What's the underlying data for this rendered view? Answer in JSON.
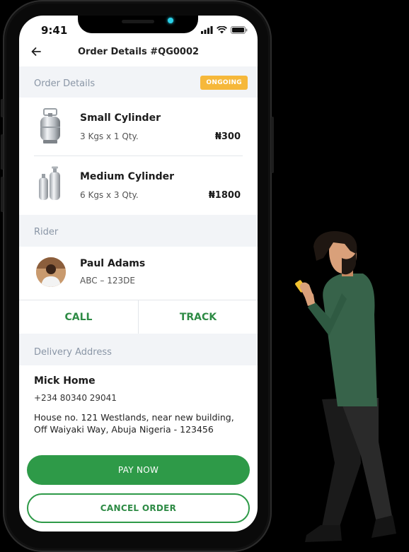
{
  "status_bar": {
    "time": "9:41"
  },
  "header": {
    "title": "Order Details #QG0002"
  },
  "order_section": {
    "label": "Order Details",
    "status": "ONGOING",
    "items": [
      {
        "name": "Small Cylinder",
        "qty": "3 Kgs x 1 Qty.",
        "price": "₦300"
      },
      {
        "name": "Medium Cylinder",
        "qty": "6 Kgs x 3 Qty.",
        "price": "₦1800"
      }
    ]
  },
  "rider_section": {
    "label": "Rider",
    "name": "Paul Adams",
    "plate": "ABC – 123DE",
    "call_label": "CALL",
    "track_label": "TRACK"
  },
  "address_section": {
    "label": "Delivery Address",
    "name": "Mick Home",
    "phone": "+234 80340 29041",
    "line1": "House no. 121 Westlands, near new building,",
    "line2": "Off Waiyaki Way, Abuja Nigeria - 123456"
  },
  "buttons": {
    "pay": "PAY NOW",
    "cancel": "CANCEL ORDER"
  },
  "colors": {
    "accent": "#2e9a48",
    "badge": "#f6b83a",
    "section_bg": "#f2f4f7"
  }
}
